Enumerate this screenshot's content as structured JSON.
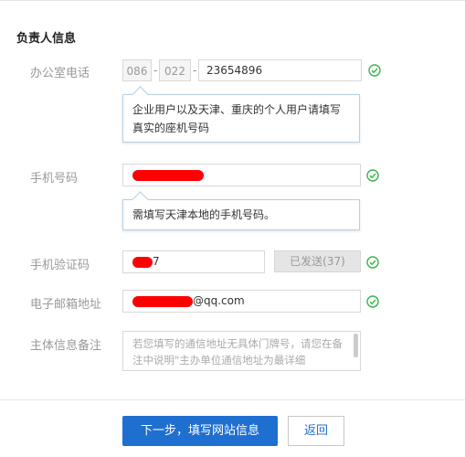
{
  "section": {
    "title": "负责人信息"
  },
  "office_phone": {
    "label": "办公室电话",
    "country_code": "086",
    "area_code": "022",
    "number": "23654896",
    "dash": "-",
    "tip": "企业用户以及天津、重庆的个人用户请填写真实的座机号码"
  },
  "mobile": {
    "label": "手机号码",
    "tip": "需填写天津本地的手机号码。"
  },
  "sms_code": {
    "label": "手机验证码",
    "value_suffix": "7",
    "sent_button": "已发送(37)"
  },
  "email": {
    "label": "电子邮箱地址",
    "domain": "@qq.com"
  },
  "remarks": {
    "label": "主体信息备注",
    "placeholder": "若您填写的通信地址无具体门牌号，请您在备注中说明\"主办单位通信地址为最详细"
  },
  "actions": {
    "next": "下一步，填写网站信息",
    "back": "返回"
  },
  "colors": {
    "primary": "#1f6fd1",
    "ok_green": "#39b54a",
    "redaction": "#ff0000"
  },
  "icons": {
    "valid": "check-circle-icon"
  }
}
